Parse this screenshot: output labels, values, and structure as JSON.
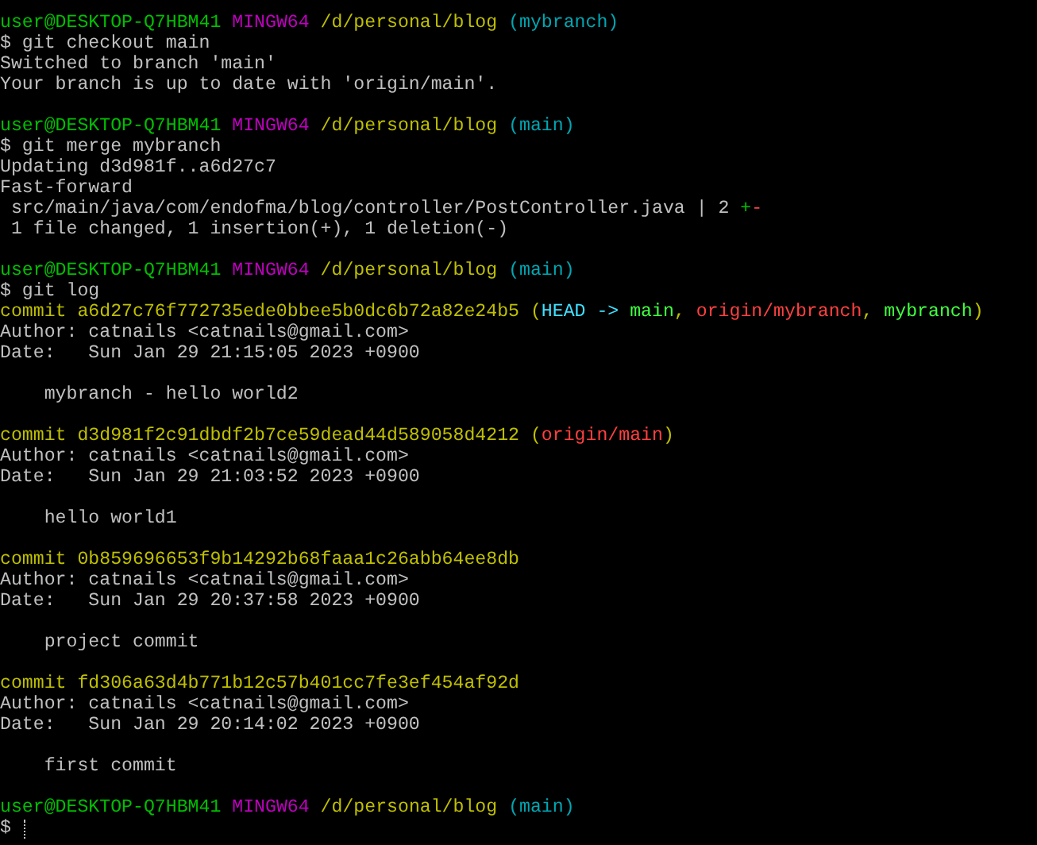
{
  "terminal": {
    "lines": [
      {
        "kind": "text",
        "segments": [
          {
            "text": "user@DESKTOP-Q7HBM41 ",
            "color": "#00bf00"
          },
          {
            "text": "MINGW64 ",
            "color": "#bf00bf"
          },
          {
            "text": "/d/personal/blog ",
            "color": "#bfbf00"
          },
          {
            "text": "(mybranch)",
            "color": "#00a6b2"
          }
        ]
      },
      {
        "kind": "text",
        "segments": [
          {
            "text": "$ git checkout main",
            "color": "#c0c0c0"
          }
        ]
      },
      {
        "kind": "text",
        "segments": [
          {
            "text": "Switched to branch 'main'",
            "color": "#c0c0c0"
          }
        ]
      },
      {
        "kind": "text",
        "segments": [
          {
            "text": "Your branch is up to date with 'origin/main'.",
            "color": "#c0c0c0"
          }
        ]
      },
      {
        "kind": "blank"
      },
      {
        "kind": "text",
        "segments": [
          {
            "text": "user@DESKTOP-Q7HBM41 ",
            "color": "#00bf00"
          },
          {
            "text": "MINGW64 ",
            "color": "#bf00bf"
          },
          {
            "text": "/d/personal/blog ",
            "color": "#bfbf00"
          },
          {
            "text": "(main)",
            "color": "#00a6b2"
          }
        ]
      },
      {
        "kind": "text",
        "segments": [
          {
            "text": "$ git merge mybranch",
            "color": "#c0c0c0"
          }
        ]
      },
      {
        "kind": "text",
        "segments": [
          {
            "text": "Updating d3d981f..a6d27c7",
            "color": "#c0c0c0"
          }
        ]
      },
      {
        "kind": "text",
        "segments": [
          {
            "text": "Fast-forward",
            "color": "#c0c0c0"
          }
        ]
      },
      {
        "kind": "text",
        "segments": [
          {
            "text": " src/main/java/com/endofma/blog/controller/PostController.java | 2 ",
            "color": "#c0c0c0"
          },
          {
            "text": "+",
            "color": "#00bf00"
          },
          {
            "text": "-",
            "color": "#ff4040"
          }
        ]
      },
      {
        "kind": "text",
        "segments": [
          {
            "text": " 1 file changed, 1 insertion(+), 1 deletion(-)",
            "color": "#c0c0c0"
          }
        ]
      },
      {
        "kind": "blank"
      },
      {
        "kind": "text",
        "segments": [
          {
            "text": "user@DESKTOP-Q7HBM41 ",
            "color": "#00bf00"
          },
          {
            "text": "MINGW64 ",
            "color": "#bf00bf"
          },
          {
            "text": "/d/personal/blog ",
            "color": "#bfbf00"
          },
          {
            "text": "(main)",
            "color": "#00a6b2"
          }
        ]
      },
      {
        "kind": "text",
        "segments": [
          {
            "text": "$ git log",
            "color": "#c0c0c0"
          }
        ]
      },
      {
        "kind": "text",
        "segments": [
          {
            "text": "commit a6d27c76f772735ede0bbee5b0dc6b72a82e24b5 (",
            "color": "#bfbf00"
          },
          {
            "text": "HEAD -> ",
            "color": "#40e0ff"
          },
          {
            "text": "main",
            "color": "#40ff40"
          },
          {
            "text": ", ",
            "color": "#bfbf00"
          },
          {
            "text": "origin/mybranch",
            "color": "#ff4040"
          },
          {
            "text": ", ",
            "color": "#bfbf00"
          },
          {
            "text": "mybranch",
            "color": "#40ff40"
          },
          {
            "text": ")",
            "color": "#bfbf00"
          }
        ]
      },
      {
        "kind": "text",
        "segments": [
          {
            "text": "Author: catnails <catnails@gmail.com>",
            "color": "#c0c0c0"
          }
        ]
      },
      {
        "kind": "text",
        "segments": [
          {
            "text": "Date:   Sun Jan 29 21:15:05 2023 +0900",
            "color": "#c0c0c0"
          }
        ]
      },
      {
        "kind": "blank"
      },
      {
        "kind": "text",
        "segments": [
          {
            "text": "    mybranch - hello world2",
            "color": "#c0c0c0"
          }
        ]
      },
      {
        "kind": "blank"
      },
      {
        "kind": "text",
        "segments": [
          {
            "text": "commit d3d981f2c91dbdf2b7ce59dead44d589058d4212 (",
            "color": "#bfbf00"
          },
          {
            "text": "origin/main",
            "color": "#ff4040"
          },
          {
            "text": ")",
            "color": "#bfbf00"
          }
        ]
      },
      {
        "kind": "text",
        "segments": [
          {
            "text": "Author: catnails <catnails@gmail.com>",
            "color": "#c0c0c0"
          }
        ]
      },
      {
        "kind": "text",
        "segments": [
          {
            "text": "Date:   Sun Jan 29 21:03:52 2023 +0900",
            "color": "#c0c0c0"
          }
        ]
      },
      {
        "kind": "blank"
      },
      {
        "kind": "text",
        "segments": [
          {
            "text": "    hello world1",
            "color": "#c0c0c0"
          }
        ]
      },
      {
        "kind": "blank"
      },
      {
        "kind": "text",
        "segments": [
          {
            "text": "commit 0b859696653f9b14292b68faaa1c26abb64ee8db",
            "color": "#bfbf00"
          }
        ]
      },
      {
        "kind": "text",
        "segments": [
          {
            "text": "Author: catnails <catnails@gmail.com>",
            "color": "#c0c0c0"
          }
        ]
      },
      {
        "kind": "text",
        "segments": [
          {
            "text": "Date:   Sun Jan 29 20:37:58 2023 +0900",
            "color": "#c0c0c0"
          }
        ]
      },
      {
        "kind": "blank"
      },
      {
        "kind": "text",
        "segments": [
          {
            "text": "    project commit",
            "color": "#c0c0c0"
          }
        ]
      },
      {
        "kind": "blank"
      },
      {
        "kind": "text",
        "segments": [
          {
            "text": "commit fd306a63d4b771b12c57b401cc7fe3ef454af92d",
            "color": "#bfbf00"
          }
        ]
      },
      {
        "kind": "text",
        "segments": [
          {
            "text": "Author: catnails <catnails@gmail.com>",
            "color": "#c0c0c0"
          }
        ]
      },
      {
        "kind": "text",
        "segments": [
          {
            "text": "Date:   Sun Jan 29 20:14:02 2023 +0900",
            "color": "#c0c0c0"
          }
        ]
      },
      {
        "kind": "blank"
      },
      {
        "kind": "text",
        "segments": [
          {
            "text": "    first commit",
            "color": "#c0c0c0"
          }
        ]
      },
      {
        "kind": "blank"
      },
      {
        "kind": "text",
        "segments": [
          {
            "text": "user@DESKTOP-Q7HBM41 ",
            "color": "#00bf00"
          },
          {
            "text": "MINGW64 ",
            "color": "#bf00bf"
          },
          {
            "text": "/d/personal/blog ",
            "color": "#bfbf00"
          },
          {
            "text": "(main)",
            "color": "#00a6b2"
          }
        ]
      },
      {
        "kind": "input",
        "segments": [
          {
            "text": "$ ",
            "color": "#c0c0c0"
          }
        ],
        "cursor": true
      }
    ]
  }
}
